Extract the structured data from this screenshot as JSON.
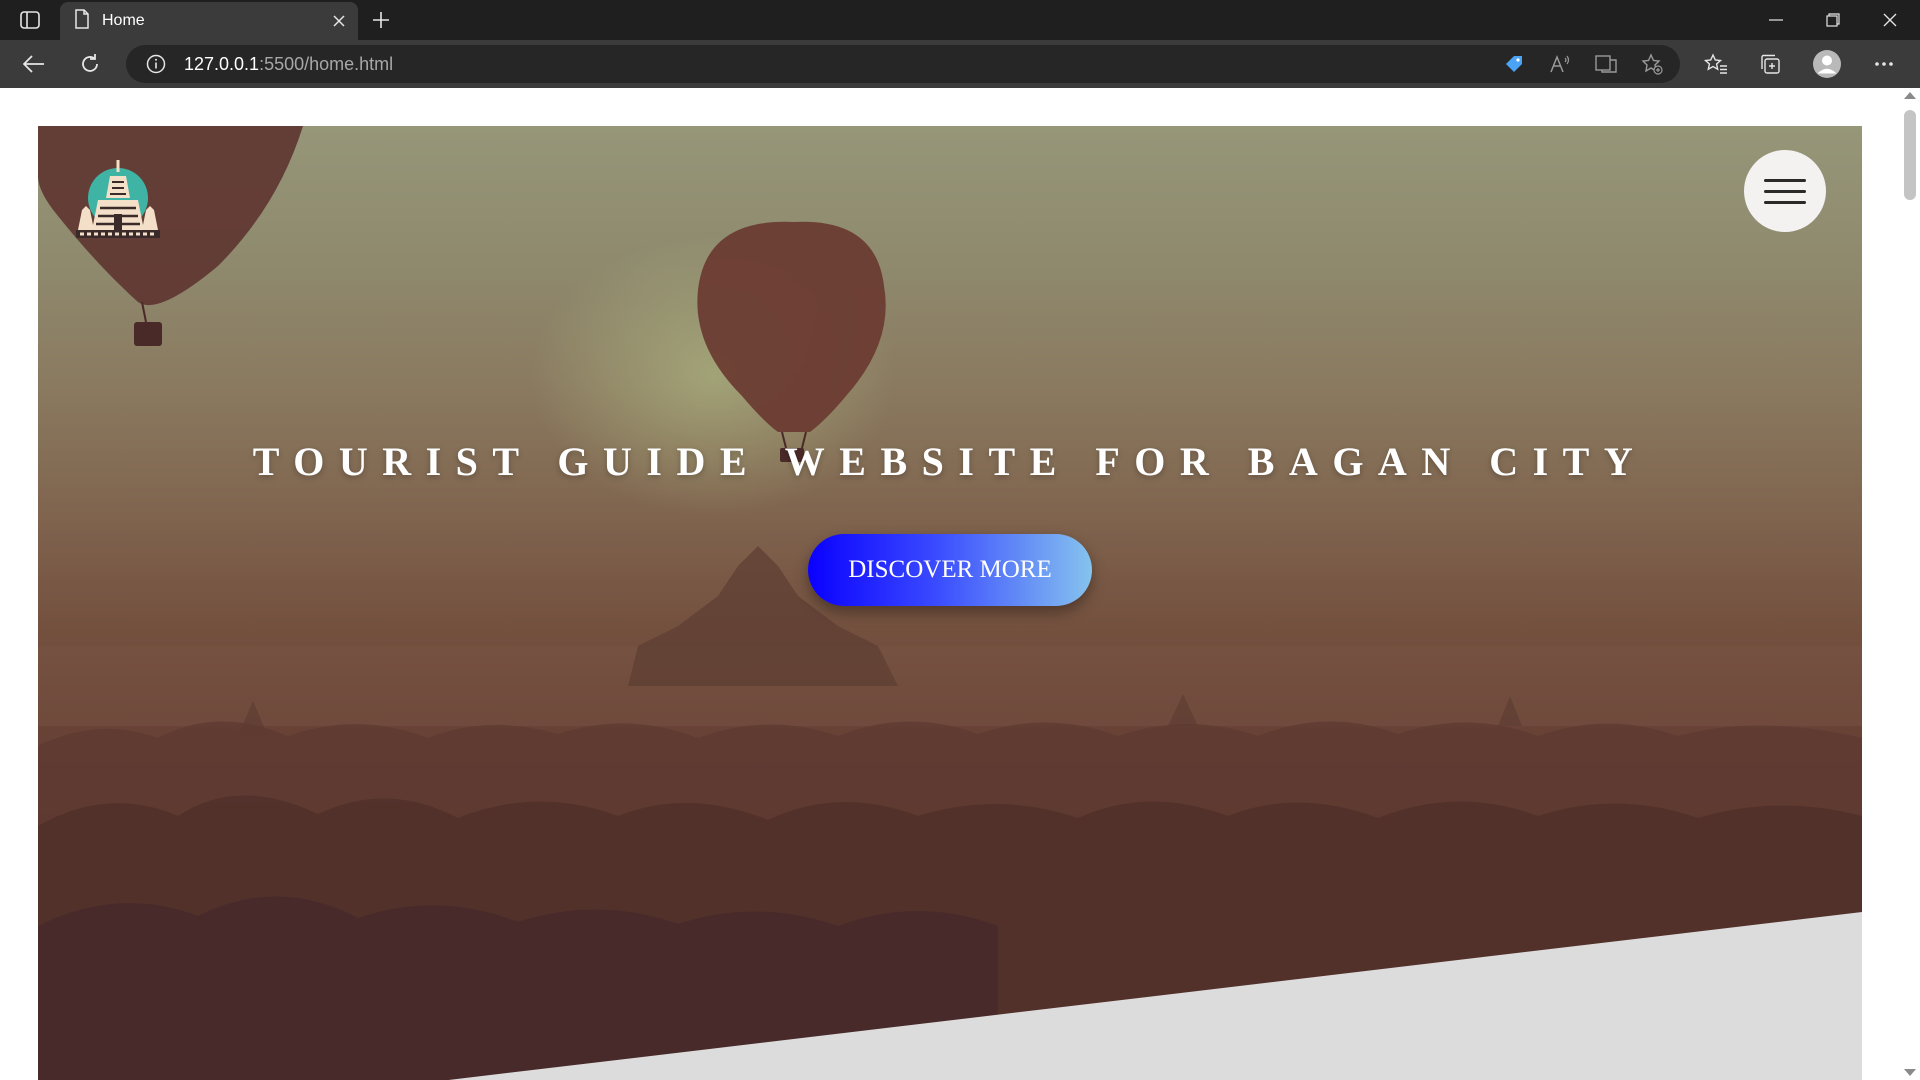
{
  "browser": {
    "tab_title": "Home",
    "url_host": "127.0.0.1",
    "url_path": ":5500/home.html"
  },
  "page": {
    "hero_title": "TOURIST GUIDE WEBSITE FOR BAGAN CITY",
    "cta_label": "DISCOVER MORE"
  },
  "colors": {
    "chrome_dark": "#1f1f1f",
    "chrome_toolbar": "#3b3b3b",
    "cta_start": "#0a00ff",
    "cta_end": "#86c3ee",
    "hero_bottom_band": "#dcdcdc"
  },
  "icons": {
    "sidebar": "sidebar-toggle-icon",
    "tab": "page-icon",
    "close": "close-icon",
    "new_tab": "plus-icon",
    "back": "back-arrow-icon",
    "refresh": "refresh-icon",
    "info": "info-icon",
    "coupon": "tag-icon",
    "read_aloud": "read-aloud-icon",
    "immersive": "immersive-reader-icon",
    "favorite": "add-favorite-icon",
    "favorites": "favorites-icon",
    "collections": "collections-icon",
    "profile": "profile-icon",
    "more": "more-icon",
    "menu": "hamburger-menu-icon"
  }
}
